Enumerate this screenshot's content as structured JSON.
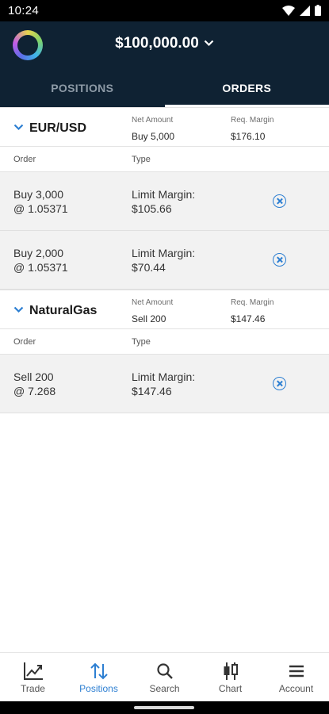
{
  "status_bar": {
    "time": "10:24"
  },
  "header": {
    "balance": "$100,000.00"
  },
  "tabs": [
    {
      "label": "POSITIONS",
      "active": false
    },
    {
      "label": "ORDERS",
      "active": true
    }
  ],
  "groups": [
    {
      "symbol": "EUR/USD",
      "net_amount_label": "Net Amount",
      "net_amount": "Buy 5,000",
      "req_margin_label": "Req. Margin",
      "req_margin": "$176.10",
      "col_order": "Order",
      "col_type": "Type",
      "orders": [
        {
          "order": "Buy 3,000\n@ 1.05371",
          "type": "Limit Margin:\n$105.66"
        },
        {
          "order": "Buy 2,000\n@ 1.05371",
          "type": "Limit Margin:\n$70.44"
        }
      ]
    },
    {
      "symbol": "NaturalGas",
      "net_amount_label": "Net Amount",
      "net_amount": "Sell 200",
      "req_margin_label": "Req. Margin",
      "req_margin": "$147.46",
      "col_order": "Order",
      "col_type": "Type",
      "orders": [
        {
          "order": "Sell 200\n@ 7.268",
          "type": "Limit Margin:\n$147.46"
        }
      ]
    }
  ],
  "bottom_nav": [
    {
      "label": "Trade",
      "icon": "chart-trend-icon",
      "active": false
    },
    {
      "label": "Positions",
      "icon": "swap-vertical-icon",
      "active": true
    },
    {
      "label": "Search",
      "icon": "search-icon",
      "active": false
    },
    {
      "label": "Chart",
      "icon": "candlestick-icon",
      "active": false
    },
    {
      "label": "Account",
      "icon": "menu-icon",
      "active": false
    }
  ],
  "colors": {
    "header_bg": "#0f2233",
    "accent": "#2d7fd2",
    "row_bg": "#f2f2f2"
  }
}
